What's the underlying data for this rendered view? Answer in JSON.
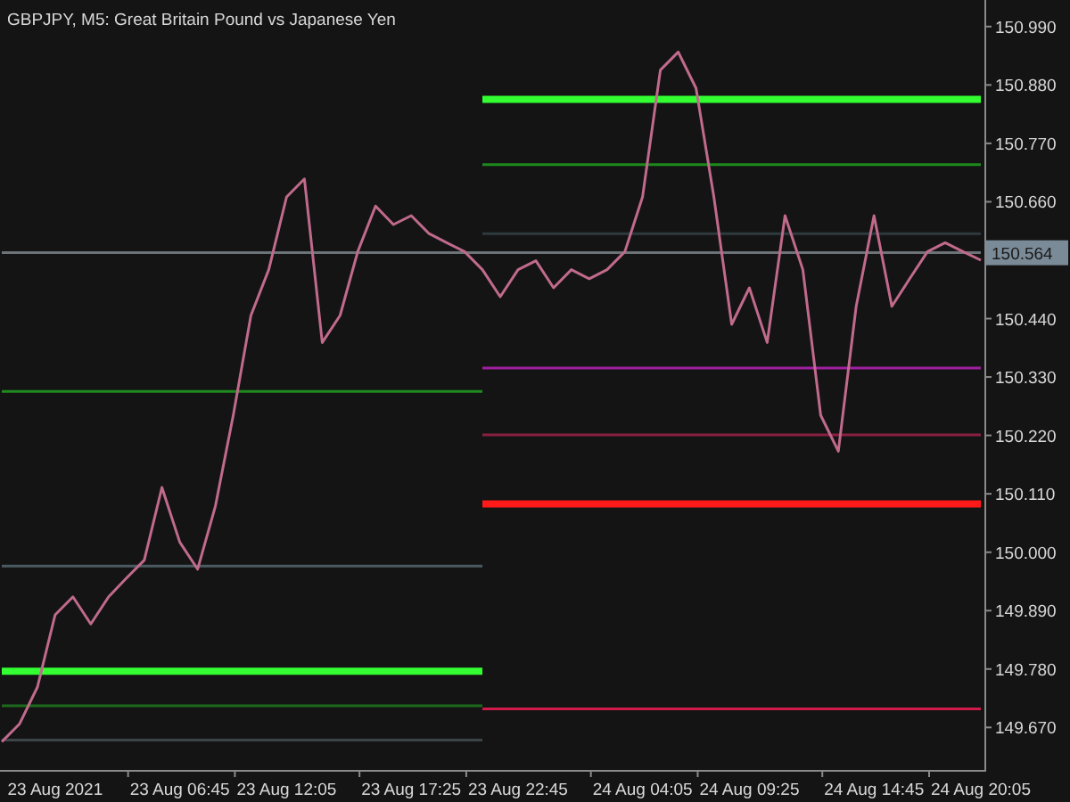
{
  "chart": {
    "title": "GBPJPY, M5:  Great Britain Pound vs Japanese Yen",
    "current_price": "150.564",
    "chart_data": {
      "type": "line",
      "categories": [
        null,
        null,
        null,
        "23 Aug 2021",
        null,
        null,
        null,
        null,
        null,
        null,
        "23 Aug 06:45",
        null,
        null,
        null,
        null,
        null,
        "23 Aug 12:05",
        null,
        null,
        null,
        null,
        null,
        null,
        "23 Aug 17:25",
        null,
        null,
        null,
        null,
        null,
        "23 Aug 22:45",
        null,
        null,
        null,
        null,
        null,
        null,
        "24 Aug 04:05",
        null,
        null,
        null,
        null,
        null,
        "24 Aug 09:25",
        null,
        null,
        null,
        null,
        null,
        null,
        "24 Aug 14:45",
        null,
        null,
        null,
        null,
        null,
        "24 Aug 20:05"
      ],
      "series": [
        {
          "color": "#6b7378",
          "values": [
            150.564,
            150.564,
            150.564,
            150.564,
            150.564,
            150.564,
            150.564,
            150.564,
            150.564,
            150.564,
            150.564,
            150.564,
            150.564,
            150.564,
            150.564,
            150.564,
            150.564,
            150.564,
            150.564,
            150.564,
            150.564,
            150.564,
            150.564,
            150.564,
            150.564,
            150.564,
            150.564,
            150.564,
            150.564,
            150.564,
            150.564,
            150.564,
            150.564,
            150.564,
            150.564,
            150.564,
            150.564,
            150.564,
            150.564,
            150.564,
            150.564,
            150.564,
            150.564,
            150.564,
            150.564,
            150.564,
            150.564,
            150.564,
            150.564,
            150.564,
            150.564,
            150.564,
            150.564,
            150.564,
            150.564,
            150.564
          ]
        },
        {
          "color": "#1f8a1f",
          "values": [
            150.303,
            150.303,
            150.303,
            150.303,
            150.303,
            150.303,
            150.303,
            150.303,
            150.303,
            150.303,
            150.303,
            150.303,
            150.303,
            150.303,
            150.303,
            150.303,
            150.303,
            150.303,
            150.303,
            150.303,
            150.303,
            150.303,
            150.303,
            150.303,
            150.303,
            150.303,
            150.303,
            150.303,
            null,
            null,
            null,
            null,
            null,
            null,
            null,
            null,
            null,
            null,
            null,
            null,
            null,
            null,
            null,
            null,
            null,
            null,
            null,
            null,
            null,
            null,
            null,
            null,
            null,
            null,
            null,
            null
          ]
        },
        {
          "color": "#4a5a60",
          "values": [
            149.974,
            149.974,
            149.974,
            149.974,
            149.974,
            149.974,
            149.974,
            149.974,
            149.974,
            149.974,
            149.974,
            149.974,
            149.974,
            149.974,
            149.974,
            149.974,
            149.974,
            149.974,
            149.974,
            149.974,
            149.974,
            149.974,
            149.974,
            149.974,
            149.974,
            149.974,
            149.974,
            149.974,
            null,
            null,
            null,
            null,
            null,
            null,
            null,
            null,
            null,
            null,
            null,
            null,
            null,
            null,
            null,
            null,
            null,
            null,
            null,
            null,
            null,
            null,
            null,
            null,
            null,
            null,
            null,
            null
          ]
        },
        {
          "color": "#33ff33",
          "values": [
            149.776,
            149.776,
            149.776,
            149.776,
            149.776,
            149.776,
            149.776,
            149.776,
            149.776,
            149.776,
            149.776,
            149.776,
            149.776,
            149.776,
            149.776,
            149.776,
            149.776,
            149.776,
            149.776,
            149.776,
            149.776,
            149.776,
            149.776,
            149.776,
            149.776,
            149.776,
            149.776,
            149.776,
            null,
            null,
            null,
            null,
            null,
            null,
            null,
            null,
            null,
            null,
            null,
            null,
            null,
            null,
            null,
            null,
            null,
            null,
            null,
            null,
            null,
            null,
            null,
            null,
            null,
            null,
            null,
            null
          ]
        },
        {
          "color": "#1c6b1c",
          "values": [
            149.711,
            149.711,
            149.711,
            149.711,
            149.711,
            149.711,
            149.711,
            149.711,
            149.711,
            149.711,
            149.711,
            149.711,
            149.711,
            149.711,
            149.711,
            149.711,
            149.711,
            149.711,
            149.711,
            149.711,
            149.711,
            149.711,
            149.711,
            149.711,
            149.711,
            149.711,
            149.711,
            149.711,
            null,
            null,
            null,
            null,
            null,
            null,
            null,
            null,
            null,
            null,
            null,
            null,
            null,
            null,
            null,
            null,
            null,
            null,
            null,
            null,
            null,
            null,
            null,
            null,
            null,
            null,
            null,
            null
          ]
        },
        {
          "color": "#3c4448",
          "values": [
            149.646,
            149.646,
            149.646,
            149.646,
            149.646,
            149.646,
            149.646,
            149.646,
            149.646,
            149.646,
            149.646,
            149.646,
            149.646,
            149.646,
            149.646,
            149.646,
            149.646,
            149.646,
            149.646,
            149.646,
            149.646,
            149.646,
            149.646,
            149.646,
            149.646,
            149.646,
            149.646,
            149.646,
            null,
            null,
            null,
            null,
            null,
            null,
            null,
            null,
            null,
            null,
            null,
            null,
            null,
            null,
            null,
            null,
            null,
            null,
            null,
            null,
            null,
            null,
            null,
            null,
            null,
            null,
            null,
            null
          ]
        },
        {
          "color": "#32fe32",
          "values": [
            null,
            null,
            null,
            null,
            null,
            null,
            null,
            null,
            null,
            null,
            null,
            null,
            null,
            null,
            null,
            null,
            null,
            null,
            null,
            null,
            null,
            null,
            null,
            null,
            null,
            null,
            null,
            150.853,
            150.853,
            150.853,
            150.853,
            150.853,
            150.853,
            150.853,
            150.853,
            150.853,
            150.853,
            150.853,
            150.853,
            150.853,
            150.853,
            150.853,
            150.853,
            150.853,
            150.853,
            150.853,
            150.853,
            150.853,
            150.853,
            150.853,
            150.853,
            150.853,
            150.853,
            150.853,
            150.853,
            150.853
          ]
        },
        {
          "color": "#1c8a1c",
          "values": [
            null,
            null,
            null,
            null,
            null,
            null,
            null,
            null,
            null,
            null,
            null,
            null,
            null,
            null,
            null,
            null,
            null,
            null,
            null,
            null,
            null,
            null,
            null,
            null,
            null,
            null,
            null,
            150.73,
            150.73,
            150.73,
            150.73,
            150.73,
            150.73,
            150.73,
            150.73,
            150.73,
            150.73,
            150.73,
            150.73,
            150.73,
            150.73,
            150.73,
            150.73,
            150.73,
            150.73,
            150.73,
            150.73,
            150.73,
            150.73,
            150.73,
            150.73,
            150.73,
            150.73,
            150.73,
            150.73,
            150.73
          ]
        },
        {
          "color": "#2e3a3e",
          "values": [
            null,
            null,
            null,
            null,
            null,
            null,
            null,
            null,
            null,
            null,
            null,
            null,
            null,
            null,
            null,
            null,
            null,
            null,
            null,
            null,
            null,
            null,
            null,
            null,
            null,
            null,
            null,
            150.6,
            150.6,
            150.6,
            150.6,
            150.6,
            150.6,
            150.6,
            150.6,
            150.6,
            150.6,
            150.6,
            150.6,
            150.6,
            150.6,
            150.6,
            150.6,
            150.6,
            150.6,
            150.6,
            150.6,
            150.6,
            150.6,
            150.6,
            150.6,
            150.6,
            150.6,
            150.6,
            150.6,
            150.6
          ]
        },
        {
          "color": "#a020a0",
          "values": [
            null,
            null,
            null,
            null,
            null,
            null,
            null,
            null,
            null,
            null,
            null,
            null,
            null,
            null,
            null,
            null,
            null,
            null,
            null,
            null,
            null,
            null,
            null,
            null,
            null,
            null,
            null,
            150.347,
            150.347,
            150.347,
            150.347,
            150.347,
            150.347,
            150.347,
            150.347,
            150.347,
            150.347,
            150.347,
            150.347,
            150.347,
            150.347,
            150.347,
            150.347,
            150.347,
            150.347,
            150.347,
            150.347,
            150.347,
            150.347,
            150.347,
            150.347,
            150.347,
            150.347,
            150.347,
            150.347,
            150.347
          ]
        },
        {
          "color": "#8a2040",
          "values": [
            null,
            null,
            null,
            null,
            null,
            null,
            null,
            null,
            null,
            null,
            null,
            null,
            null,
            null,
            null,
            null,
            null,
            null,
            null,
            null,
            null,
            null,
            null,
            null,
            null,
            null,
            null,
            150.221,
            150.221,
            150.221,
            150.221,
            150.221,
            150.221,
            150.221,
            150.221,
            150.221,
            150.221,
            150.221,
            150.221,
            150.221,
            150.221,
            150.221,
            150.221,
            150.221,
            150.221,
            150.221,
            150.221,
            150.221,
            150.221,
            150.221,
            150.221,
            150.221,
            150.221,
            150.221,
            150.221,
            150.221
          ]
        },
        {
          "color": "#ff1a1a",
          "values": [
            null,
            null,
            null,
            null,
            null,
            null,
            null,
            null,
            null,
            null,
            null,
            null,
            null,
            null,
            null,
            null,
            null,
            null,
            null,
            null,
            null,
            null,
            null,
            null,
            null,
            null,
            null,
            150.091,
            150.091,
            150.091,
            150.091,
            150.091,
            150.091,
            150.091,
            150.091,
            150.091,
            150.091,
            150.091,
            150.091,
            150.091,
            150.091,
            150.091,
            150.091,
            150.091,
            150.091,
            150.091,
            150.091,
            150.091,
            150.091,
            150.091,
            150.091,
            150.091,
            150.091,
            150.091,
            150.091,
            150.091
          ]
        },
        {
          "color": "#d01a4a",
          "values": [
            null,
            null,
            null,
            null,
            null,
            null,
            null,
            null,
            null,
            null,
            null,
            null,
            null,
            null,
            null,
            null,
            null,
            null,
            null,
            null,
            null,
            null,
            null,
            null,
            null,
            null,
            null,
            149.705,
            149.705,
            149.705,
            149.705,
            149.705,
            149.705,
            149.705,
            149.705,
            149.705,
            149.705,
            149.705,
            149.705,
            149.705,
            149.705,
            149.705,
            149.705,
            149.705,
            149.705,
            149.705,
            149.705,
            149.705,
            149.705,
            149.705,
            149.705,
            149.705,
            149.705,
            149.705,
            149.705,
            149.705
          ]
        },
        {
          "color": "#c06a8c",
          "values": [
            149.643,
            149.677,
            149.746,
            149.882,
            149.916,
            149.865,
            149.916,
            149.951,
            149.985,
            150.122,
            150.019,
            149.968,
            150.087,
            150.258,
            150.446,
            150.532,
            150.669,
            150.703,
            150.395,
            150.446,
            150.566,
            150.652,
            150.617,
            150.634,
            150.6,
            150.583,
            150.566,
            150.532,
            150.481,
            150.532,
            150.549,
            150.498,
            150.532,
            150.515,
            150.532,
            150.566,
            150.669,
            150.908,
            150.942,
            150.874,
            150.669,
            150.429,
            150.498,
            150.395,
            150.634,
            150.532,
            150.258,
            150.19,
            150.463,
            150.634,
            150.463,
            150.515,
            150.566,
            150.583,
            150.566,
            150.55
          ]
        }
      ],
      "ylim": [
        149.59,
        151.04
      ],
      "yticks": [
        {
          "value": 150.99,
          "label": "150.990"
        },
        {
          "value": 150.88,
          "label": "150.880"
        },
        {
          "value": 150.77,
          "label": "150.770"
        },
        {
          "value": 150.66,
          "label": "150.660"
        },
        {
          "value": 150.44,
          "label": "150.440"
        },
        {
          "value": 150.33,
          "label": "150.330"
        },
        {
          "value": 150.22,
          "label": "150.220"
        },
        {
          "value": 150.11,
          "label": "150.110"
        },
        {
          "value": 150.0,
          "label": "150.000"
        },
        {
          "value": 149.89,
          "label": "149.890"
        },
        {
          "value": 149.78,
          "label": "149.780"
        },
        {
          "value": 149.67,
          "label": "149.670"
        }
      ]
    }
  }
}
